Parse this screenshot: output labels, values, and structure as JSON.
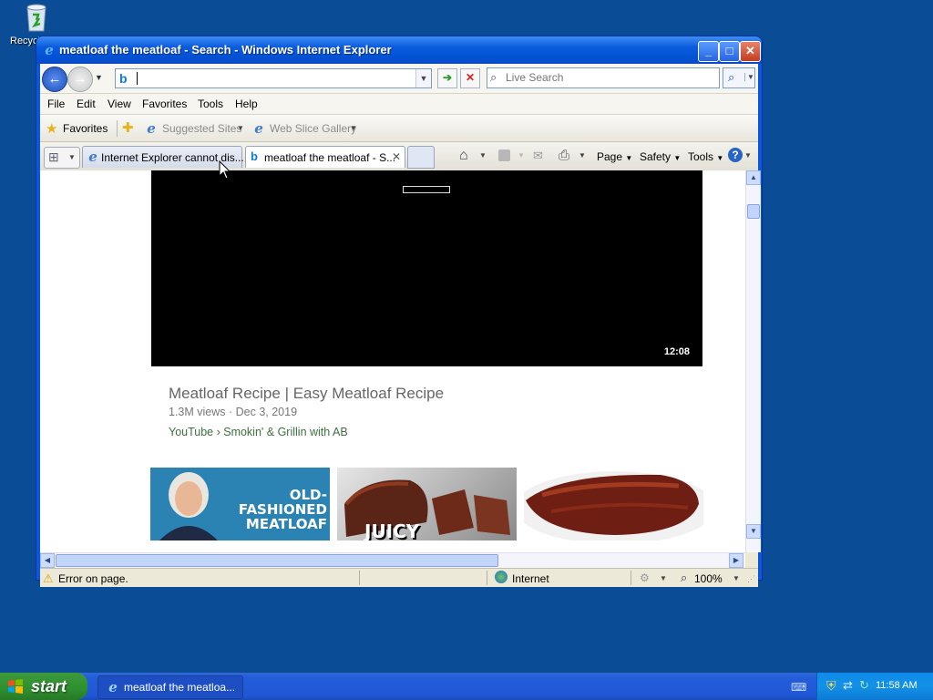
{
  "desktop": {
    "recycle_label": "Recycle Bin"
  },
  "window": {
    "title": "meatloaf the meatloaf - Search - Windows Internet Explorer",
    "caption_buttons": {
      "minimize": "_",
      "maximize": "□",
      "close": "✕"
    }
  },
  "address_bar": {
    "value": "",
    "go_icon": "➔",
    "stop_icon": "✕"
  },
  "search": {
    "placeholder": "Live Search"
  },
  "menu": [
    "File",
    "Edit",
    "View",
    "Favorites",
    "Tools",
    "Help"
  ],
  "favorites_bar": {
    "favorites_label": "Favorites",
    "suggested_sites": "Suggested Sites",
    "web_slice_gallery": "Web Slice Gallery"
  },
  "tabs": [
    {
      "label": "Internet Explorer cannot dis...",
      "active": false
    },
    {
      "label": "meatloaf the meatloaf - S...",
      "active": true
    }
  ],
  "command_bar": {
    "page": "Page",
    "safety": "Safety",
    "tools": "Tools"
  },
  "video": {
    "duration": "12:08",
    "title": "Meatloaf Recipe | Easy Meatloaf Recipe",
    "meta": "1.3M views · Dec 3, 2019",
    "source": "YouTube › Smokin' & Grillin with AB"
  },
  "thumbnails": [
    {
      "caption_line1": "OLD-",
      "caption_line2": "FASHIONED",
      "caption_line3": "MEATLOAF"
    },
    {
      "caption": "JUICY"
    },
    {
      "caption": ""
    }
  ],
  "status": {
    "message": "Error on page.",
    "zone": "Internet",
    "zoom": "100%"
  },
  "taskbar": {
    "start_label": "start",
    "task_label": "meatloaf the meatloa...",
    "clock": "11:58 AM"
  },
  "colors": {
    "titlebar": "#0a5bdd",
    "desktop": "#0a4d96",
    "start_green": "#2f8f2f",
    "link_green": "#3f6e3f"
  }
}
